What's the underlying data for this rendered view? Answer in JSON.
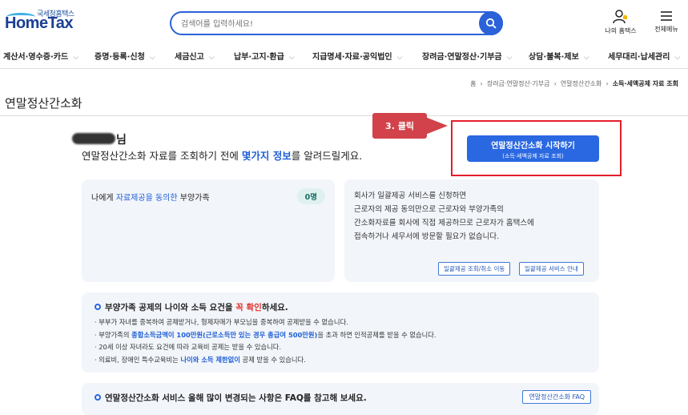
{
  "logo": {
    "sub": "국세청홈택스",
    "main": "HomeTax"
  },
  "search": {
    "placeholder": "검색어를 입력하세요!"
  },
  "header_icons": [
    {
      "label": "나의 홈택스",
      "icon": "user-bell-icon"
    },
    {
      "label": "전체메뉴",
      "icon": "menu-icon"
    }
  ],
  "nav": [
    "계산서·영수증·카드",
    "증명·등록·신청",
    "세금신고",
    "납부·고지·환급",
    "지급명세·자료·공익법인",
    "장려금·연말정산·기부금",
    "상담·불복·제보",
    "세무대리·납세관리"
  ],
  "breadcrumb": {
    "items": [
      "홈",
      "장려금·연말정산·기부금",
      "연말정산간소화"
    ],
    "current": "소득·세액공제 자료 조회"
  },
  "page_title": "연말정산간소화",
  "greeting": {
    "name_suffix": "님",
    "text_before": "연말정산간소화 자료를 조회하기 전에 ",
    "highlight": "몇가지 정보",
    "text_after": "를 알려드릴게요."
  },
  "start_button": {
    "line1": "연말정산간소화 시작하기",
    "line2": "(소득·세액공제 자료 조회)"
  },
  "callout": {
    "label": "3. 클릭"
  },
  "consent_card": {
    "prefix": "나에게 ",
    "highlight": "자료제공을 동의한",
    "suffix": " 부양가족",
    "count": "0명"
  },
  "bulk_card": {
    "lines": [
      "회사가 일괄제공 서비스를 신청하면",
      "근로자의 제공 동의만으로 근로자와 부양가족의",
      "간소화자료를 회사에 직접 제공하므로 근로자가 홈택스에",
      "접속하거나 세무서에 방문할 필요가 없습니다."
    ],
    "buttons": [
      "일괄제공 조회/취소 이동",
      "일괄제공 서비스 안내"
    ]
  },
  "info": {
    "title_a": "부양가족 공제의 나이와 소득 요건을 ",
    "title_red": "꼭 확인",
    "title_b": "하세요.",
    "items": [
      {
        "a": "부부가 자녀를 중복하여 공제받거나, 형제자매가 부모님을 중복하여 공제받을 수 없습니다."
      },
      {
        "a": "부양가족의 ",
        "blue": "종합소득금액이 100만원(근로소득만 있는 경우 총급여 500만원)",
        "b": "을 초과 하면 인적공제를 받을 수 없습니다."
      },
      {
        "a": "20세 이상 자녀라도 요건에 따라 교육비 공제는 받을 수 있습니다."
      },
      {
        "a": "의료비, 장애인 특수교육비는 ",
        "blue": "나이와 소득 제한없이",
        "b": " 공제 받을 수 있습니다."
      }
    ]
  },
  "faq": {
    "title": "연말정산간소화 서비스 올해 많이 변경되는 사항은 FAQ를 참고해 보세요.",
    "button": "연말정산간소화 FAQ"
  },
  "colors": {
    "primary": "#2a68e2",
    "callout": "#d2424a",
    "highlight_box": "#e41e2b"
  }
}
